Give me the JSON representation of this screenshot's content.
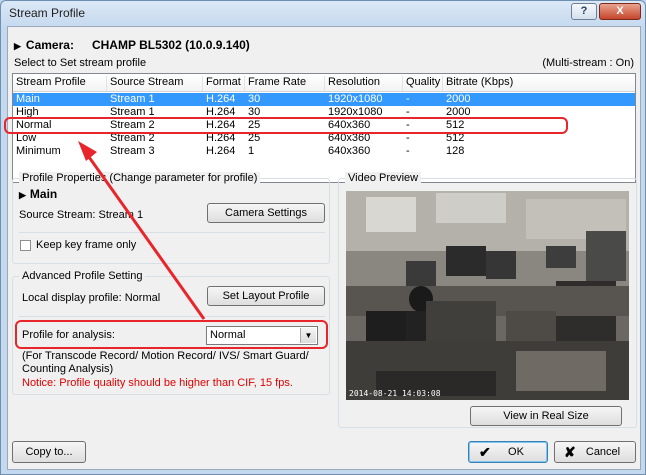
{
  "window": {
    "title": "Stream Profile",
    "help_label": "?",
    "close_label": "X"
  },
  "camera": {
    "label": "Camera:",
    "name": "CHAMP BL5302 (10.0.9.140)"
  },
  "select_text": "Select to Set stream profile",
  "multi_stream": "(Multi-stream : On)",
  "table": {
    "headers": [
      "Stream Profile",
      "Source Stream",
      "Format",
      "Frame Rate",
      "Resolution",
      "Quality",
      "Bitrate (Kbps)"
    ],
    "rows": [
      [
        "Main",
        "Stream  1",
        "H.264",
        "30",
        "1920x1080",
        "-",
        "2000"
      ],
      [
        "High",
        "Stream  1",
        "H.264",
        "30",
        "1920x1080",
        "-",
        "2000"
      ],
      [
        "Normal",
        "Stream  2",
        "H.264",
        "25",
        "640x360",
        "-",
        "512"
      ],
      [
        "Low",
        "Stream  2",
        "H.264",
        "25",
        "640x360",
        "-",
        "512"
      ],
      [
        "Minimum",
        "Stream  3",
        "H.264",
        "1",
        "640x360",
        "-",
        "128"
      ]
    ],
    "selected_row": 0
  },
  "profile_properties": {
    "legend": "Profile Properties (Change parameter for profile)",
    "profile_name": "Main",
    "source_stream_label": "Source Stream:",
    "source_stream_value": "Stream 1",
    "camera_settings_label": "Camera Settings",
    "keep_key_frame_label": "Keep key frame only"
  },
  "advanced": {
    "legend": "Advanced Profile Setting",
    "local_display_label": "Local display profile:",
    "local_display_value": "Normal",
    "set_layout_label": "Set Layout Profile",
    "analysis_label": "Profile for analysis:",
    "analysis_value": "Normal",
    "note": "(For Transcode Record/ Motion Record/ IVS/ Smart Guard/ Counting Analysis)",
    "notice": "Notice: Profile quality should be higher than CIF, 15 fps."
  },
  "preview": {
    "legend": "Video Preview",
    "timestamp": "2014-08-21 14:03:08",
    "view_real_size_label": "View in Real Size"
  },
  "footer": {
    "copy_label": "Copy to...",
    "ok_label": "OK",
    "cancel_label": "Cancel"
  },
  "colors": {
    "selection": "#3399ff",
    "annotation": "#e8252b",
    "notice": "#e00000"
  }
}
